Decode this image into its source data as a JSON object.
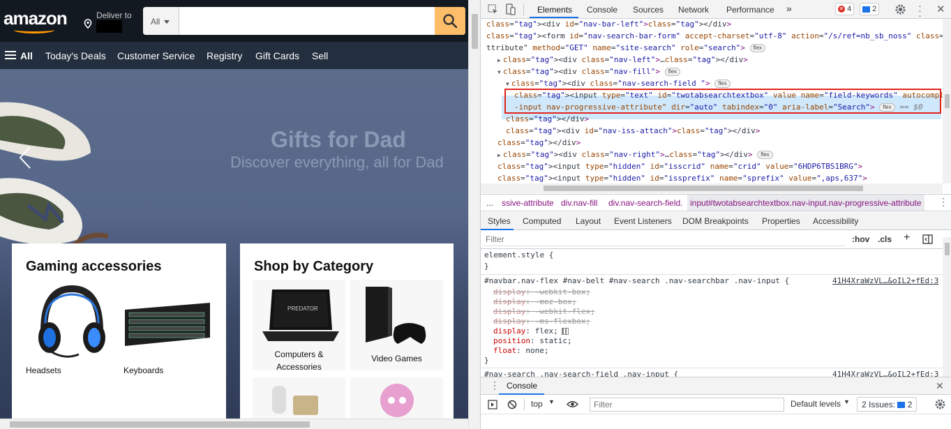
{
  "amazon": {
    "logo": "amazon",
    "deliver_to": "Deliver to",
    "search_category": "All",
    "search_value": "",
    "belt": {
      "all": "All",
      "items": [
        "Today's Deals",
        "Customer Service",
        "Registry",
        "Gift Cards",
        "Sell"
      ]
    },
    "hero": {
      "title": "Gifts for Dad",
      "subtitle": "Discover everything, all for Dad"
    },
    "cards": [
      {
        "title": "Gaming accessories",
        "tiles": [
          "Headsets",
          "Keyboards"
        ]
      },
      {
        "title": "Shop by Category",
        "tiles": [
          "Computers & Accessories",
          "Video Games"
        ]
      }
    ],
    "colors": {
      "nav": "#131921",
      "belt": "#232f3e",
      "search_btn": "#febd69",
      "smile": "#ff9900"
    }
  },
  "devtools": {
    "tabs": [
      "Elements",
      "Console",
      "Sources",
      "Network",
      "Performance"
    ],
    "more": "»",
    "errors": "4",
    "issues": "2",
    "code_lines": [
      {
        "indent": 0,
        "html": "<div id=\"nav-bar-left\"></div>"
      },
      {
        "indent": 0,
        "html": "<form id=\"nav-search-bar-form\" accept-charset=\"utf-8\" action=\"/s/ref=nb_sb_noss\" class=\"nav-searchb"
      },
      {
        "indent": 0,
        "html": "ttribute\" method=\"GET\" name=\"site-search\" role=\"search\">"
      },
      {
        "indent": 1,
        "html": "<div class=\"nav-left\">…</div>"
      },
      {
        "indent": 1,
        "html": "<div class=\"nav-fill\">"
      },
      {
        "indent": 2,
        "html": "<div class=\"nav-search-field \">"
      },
      {
        "indent": 3,
        "html": "<input type=\"text\" id=\"twotabsearchtextbox\" value name=\"field-keywords\" autocomplete=\"off\" pl"
      },
      {
        "indent": 3,
        "html": "-input nav-progressive-attribute\" dir=\"auto\" tabindex=\"0\" aria-label=\"Search\">"
      },
      {
        "indent": 2,
        "html": "</div>"
      },
      {
        "indent": 2,
        "html": "<div id=\"nav-iss-attach\"></div>"
      },
      {
        "indent": 1,
        "html": "</div>"
      },
      {
        "indent": 1,
        "html": "<div class=\"nav-right\">…</div>"
      },
      {
        "indent": 1,
        "html": "<input type=\"hidden\" id=\"isscrid\" name=\"crid\" value=\"6HDP6TBS1BRG\">"
      },
      {
        "indent": 1,
        "html": "<input type=\"hidden\" id=\"issprefix\" name=\"sprefix\" value=\",aps,637\">"
      }
    ],
    "flex_badge": "flex",
    "dollar_zero": "== $0",
    "breadcrumbs": [
      "...",
      "ssive-attribute",
      "div.nav-fill",
      "div.nav-search-field.",
      "input#twotabsearchtextbox.nav-input.nav-progressive-attribute"
    ],
    "sub_tabs": [
      "Styles",
      "Computed",
      "Layout",
      "Event Listeners",
      "DOM Breakpoints",
      "Properties",
      "Accessibility"
    ],
    "filter_placeholder": "Filter",
    "hov": ":hov",
    "cls": ".cls",
    "styles": {
      "element_style": "element.style {",
      "close": "}",
      "rule_selector": "#navbar.nav-flex #nav-belt #nav-search .nav-searchbar .nav-input {",
      "rule_source": "41H4XraWzVL…&oIL2+fEd:3",
      "props": [
        {
          "name": "display",
          "value": "-webkit-box;",
          "struck": true
        },
        {
          "name": "display",
          "value": "-moz-box;",
          "struck": true
        },
        {
          "name": "display",
          "value": "-webkit-flex;",
          "struck": true
        },
        {
          "name": "display",
          "value": "-ms-flexbox;",
          "struck": true
        },
        {
          "name": "display",
          "value": "flex;",
          "struck": false
        },
        {
          "name": "position",
          "value": "static;",
          "struck": false
        },
        {
          "name": "float",
          "value": "none;",
          "struck": false
        }
      ],
      "next_selector": "#nav-search .nav-search-field .nav-input {",
      "next_source": "41H4XraWzVL…&oIL2+fEd:3"
    },
    "drawer": {
      "tab": "Console",
      "context": "top",
      "filter_placeholder": "Filter",
      "levels": "Default levels",
      "issues_label": "2 Issues:",
      "issues_count": "2"
    }
  }
}
